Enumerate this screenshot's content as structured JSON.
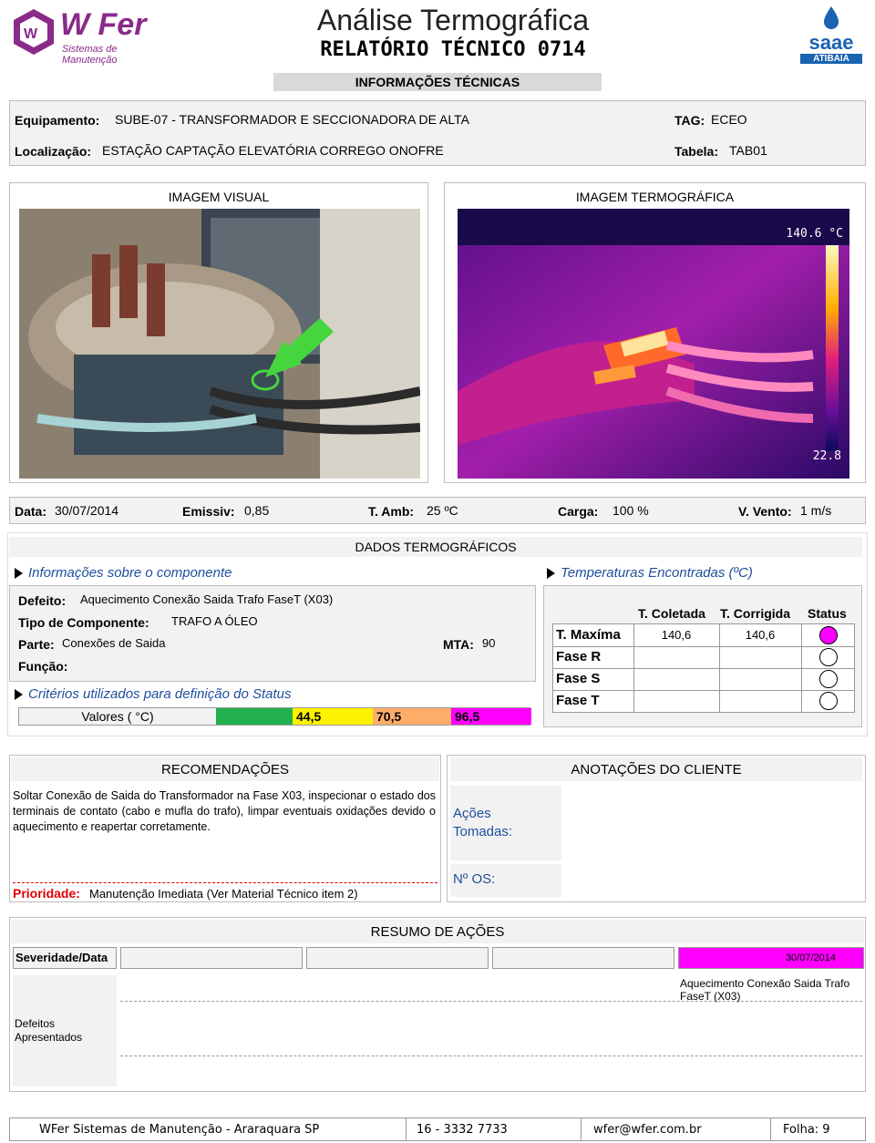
{
  "header": {
    "logo_name": "W Fer",
    "logo_sub": "Sistemas de Manutenção",
    "title": "Análise Termográfica",
    "subtitle": "RELATÓRIO TÉCNICO 0714",
    "client_logo": "saae",
    "client_logo_sub": "ATIBAIA"
  },
  "info": {
    "section_title": "INFORMAÇÕES TÉCNICAS",
    "equipamento_label": "Equipamento:",
    "equipamento_value": "SUBE-07 - TRANSFORMADOR E SECCIONADORA DE ALTA",
    "localizacao_label": "Localização:",
    "localizacao_value": "ESTAÇÃO CAPTAÇÃO ELEVATÓRIA CORREGO ONOFRE",
    "tag_label": "TAG:",
    "tag_value": "ECEO",
    "tabela_label": "Tabela:",
    "tabela_value": "TAB01"
  },
  "images": {
    "visual_title": "IMAGEM VISUAL",
    "thermo_title": "IMAGEM TERMOGRÁFICA",
    "thermo_max": "140.6 °C",
    "thermo_min": "22.8"
  },
  "conditions": {
    "data_label": "Data:",
    "data_value": "30/07/2014",
    "emissiv_label": "Emissiv:",
    "emissiv_value": "0,85",
    "tamb_label": "T. Amb:",
    "tamb_value": "25 ºC",
    "carga_label": "Carga:",
    "carga_value": "100 %",
    "vento_label": "V. Vento:",
    "vento_value": "1 m/s"
  },
  "dados": {
    "title": "DADOS TERMOGRÁFICOS",
    "info_head": "Informações sobre o componente",
    "temps_head": "Temperaturas Encontradas (ºC)",
    "defeito_label": "Defeito:",
    "defeito_value": "Aquecimento Conexão Saida Trafo FaseT (X03)",
    "tipo_label": "Tipo de Componente:",
    "tipo_value": "TRAFO A ÓLEO",
    "parte_label": "Parte:",
    "parte_value": "Conexões de Saida",
    "mta_label": "MTA:",
    "mta_value": "90",
    "funcao_label": "Função:",
    "criterios_head": "Critérios utilizados para definição do Status",
    "valores_label": "Valores ( °C)",
    "crit_1": "44,5",
    "crit_2": "70,5",
    "crit_3": "96,5",
    "col_coletada": "T. Coletada",
    "col_corrigida": "T. Corrigida",
    "col_status": "Status",
    "row_max": "T. Maxíma",
    "max_coletada": "140,6",
    "max_corrigida": "140,6",
    "row_r": "Fase R",
    "row_s": "Fase S",
    "row_t": "Fase T",
    "status_color": "#ff00ff"
  },
  "recomendacoes": {
    "title": "RECOMENDAÇÕES",
    "text": "Soltar Conexão de Saida do Transformador na Fase X03, inspecionar o estado dos terminais de contato (cabo e mufla do trafo), limpar eventuais oxidações devido o aquecimento e reapertar corretamente.",
    "prioridade_label": "Prioridade:",
    "prioridade_value": "Manutenção Imediata  (Ver Material Técnico item 2)"
  },
  "cliente": {
    "title": "ANOTAÇÕES DO CLIENTE",
    "acoes_label": "Ações Tomadas:",
    "os_label": "Nº OS:"
  },
  "resumo": {
    "title": "RESUMO DE AÇÕES",
    "severidade_label": "Severidade/Data",
    "date_value": "30/07/2014",
    "defeitos_label": "Defeitos Apresentados",
    "defeito_text": "Aquecimento Conexão Saida Trafo FaseT (X03)"
  },
  "footer": {
    "company": "WFer Sistemas de Manutenção - Araraquara SP",
    "phone": "16 - 3332 7733",
    "email": "wfer@wfer.com.br",
    "folha": "Folha: 9"
  }
}
